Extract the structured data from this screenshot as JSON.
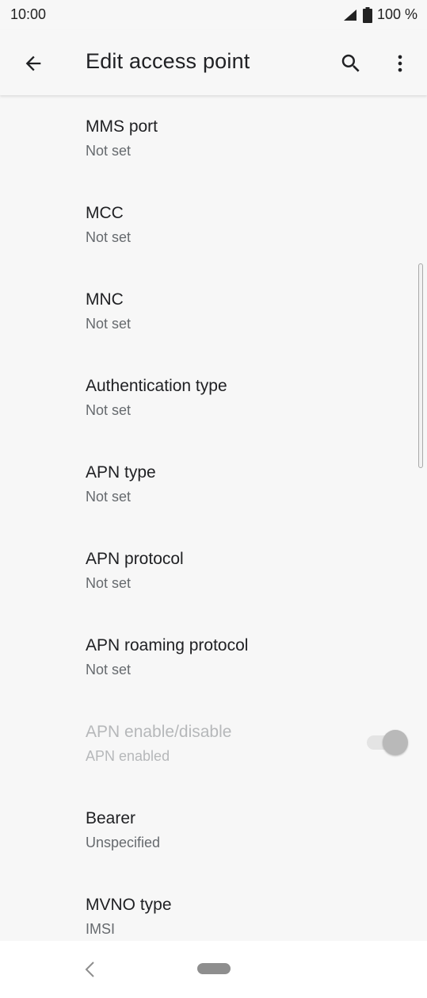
{
  "status_bar": {
    "time": "10:00",
    "battery": "100 %"
  },
  "app_bar": {
    "title": "Edit access point",
    "back_icon": "arrow-back-icon",
    "search_icon": "search-icon",
    "more_icon": "more-vert-icon"
  },
  "items": [
    {
      "title": "MMS port",
      "summary": "Not set"
    },
    {
      "title": "MCC",
      "summary": "Not set"
    },
    {
      "title": "MNC",
      "summary": "Not set"
    },
    {
      "title": "Authentication type",
      "summary": "Not set"
    },
    {
      "title": "APN type",
      "summary": "Not set"
    },
    {
      "title": "APN protocol",
      "summary": "Not set"
    },
    {
      "title": "APN roaming protocol",
      "summary": "Not set"
    },
    {
      "title": "APN enable/disable",
      "summary": "APN enabled",
      "disabled": true,
      "toggle_on": true
    },
    {
      "title": "Bearer",
      "summary": "Unspecified"
    },
    {
      "title": "MVNO type",
      "summary": "IMSI"
    }
  ],
  "colors": {
    "background": "#f7f7f7",
    "title_text": "#202124",
    "summary_text": "#666a6e",
    "disabled_text": "#b6b8ba"
  }
}
